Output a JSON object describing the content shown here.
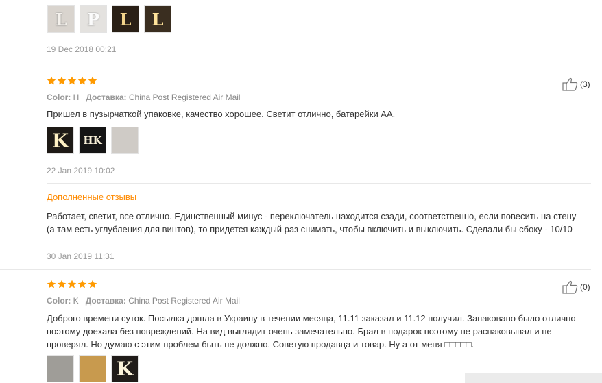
{
  "reviews": [
    {
      "date": "19 Dec 2018 00:21",
      "thumbs": [
        {
          "icon": "photo-letter-l-white"
        },
        {
          "icon": "photo-letter-p-white"
        },
        {
          "icon": "photo-letter-l-lit"
        },
        {
          "icon": "photo-letter-l-lit"
        }
      ]
    },
    {
      "rating": 5,
      "color_label": "Color:",
      "color_value": "H",
      "shipping_label": "Доставка:",
      "shipping_value": "China Post Registered Air Mail",
      "likes": "(3)",
      "text": "Пришел в пузырчаткой упаковке, качество хорошее. Светит отлично, батарейки АА.",
      "thumbs": [
        {
          "label": "K"
        },
        {
          "label": "HK"
        },
        {
          "label": ""
        }
      ],
      "date": "22 Jan 2019 10:02",
      "followup": {
        "title": "Дополненные отзывы",
        "text": "Работает, светит, все отлично. Единственный минус - переключатель находится сзади, соответственно, если повесить на стену (а там есть углубления для винтов), то придется каждый раз снимать, чтобы включить и выключить. Сделали бы сбоку - 10/10",
        "date": "30 Jan 2019 11:31"
      }
    },
    {
      "rating": 5,
      "color_label": "Color:",
      "color_value": "K",
      "shipping_label": "Доставка:",
      "shipping_value": "China Post Registered Air Mail",
      "likes": "(0)",
      "text": "Доброго времени суток. Посылка дошла в Украину в течении месяца, 11.11 заказал и 11.12 получил. Запаковано было отлично поэтому доехала без повреждений. На вид выглядит очень замечательно. Брал в подарок поэтому не распаковывал и не проверял. Но думаю с этим проблем быть не должно. Советую продавца и товар. Ну а от меня □□□□□.",
      "thumbs": [
        {
          "label": ""
        },
        {
          "label": ""
        },
        {
          "label": "K"
        }
      ]
    }
  ],
  "colors": {
    "star": "#ff9a00",
    "accent": "#ff8a00",
    "muted": "#999999"
  }
}
